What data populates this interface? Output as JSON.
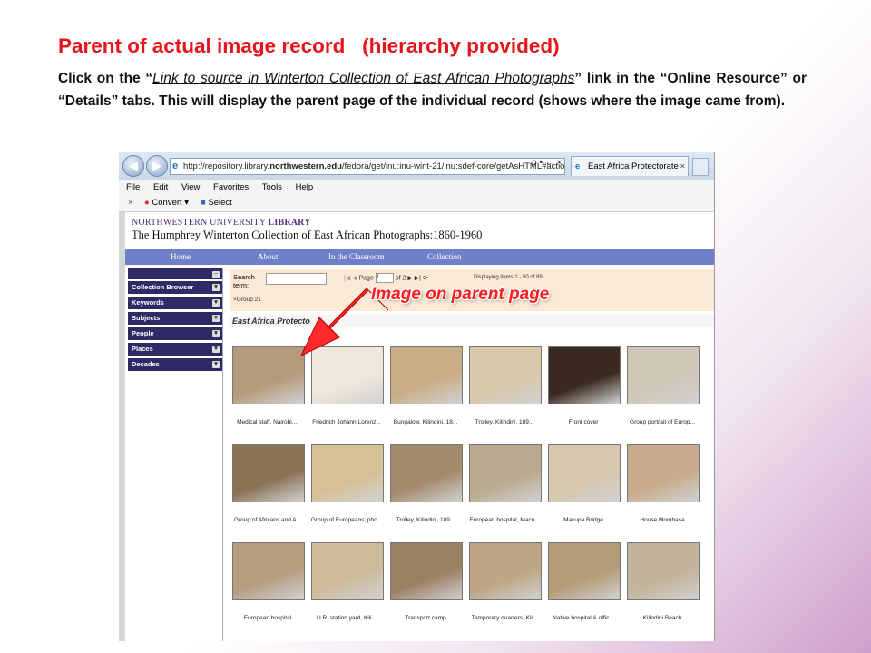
{
  "slide": {
    "title": "Parent of actual image record   (hierarchy provided)",
    "body_prefix": "Click on the “",
    "body_link": "Link to source in Winterton Collection of East African Photographs",
    "body_suffix": "” link in the “Online Resource” or “Details” tabs.  This will display the parent page of the individual record (shows where the image came from).",
    "callout": "Image on parent page"
  },
  "browser": {
    "url_prefix": "http://repository.library.",
    "url_bold": "northwestern.edu",
    "url_suffix": "/fedora/get/inu:inu-wint-21/inu:sdef-core/getAsHTML#actio",
    "addr_controls": "ρ • ← ×",
    "tab_title": "East Africa Protectorate",
    "menu": [
      "File",
      "Edit",
      "View",
      "Favorites",
      "Tools",
      "Help"
    ],
    "cmd_close": "×",
    "cmd_convert": "Convert",
    "cmd_select": "Select"
  },
  "site": {
    "library_name_regular": "NORTHWESTERN UNIVERSITY ",
    "library_name_bold": "LIBRARY",
    "collection_title": "The Humphrey Winterton Collection of East African Photographs:1860-1960",
    "nav": [
      "Home",
      "About",
      "In the Classroom",
      "Collection"
    ],
    "facets": [
      "Collection Browser",
      "Keywords",
      "Subjects",
      "People",
      "Places",
      "Decades"
    ],
    "search_label": "Search term:",
    "group_tag": "×Group 21",
    "pager_page_label": "Page",
    "pager_page_value": "1",
    "pager_of": "of 2",
    "displaying": "Displaying items 1 - 50 of 89",
    "results_title": "East Africa Protecto"
  },
  "thumbnails": [
    {
      "label": "Medical staff, Nairobi,...",
      "color": "#b49b7b"
    },
    {
      "label": "Friedrich Johann Lorenz...",
      "color": "#efe7db"
    },
    {
      "label": "Bungalow, Kilindini, 18...",
      "color": "#c9ad86"
    },
    {
      "label": "Trolley, Kilindini, 189...",
      "color": "#d8c7a8"
    },
    {
      "label": "Front cover",
      "color": "#3b2a20"
    },
    {
      "label": "Group portrait of Europ...",
      "color": "#cfc6b8"
    },
    {
      "label": "Group of Africans and A...",
      "color": "#8a7355"
    },
    {
      "label": "Group of Europeans; pho...",
      "color": "#d7c094"
    },
    {
      "label": "Trolley, Kilindini, 189...",
      "color": "#a38a6c"
    },
    {
      "label": "European hospital, Macu...",
      "color": "#b9a98f"
    },
    {
      "label": "Macupa Bridge",
      "color": "#d6c7ad"
    },
    {
      "label": "House Mombasa",
      "color": "#c8ab8a"
    },
    {
      "label": "European hospital",
      "color": "#b69d80"
    },
    {
      "label": "U.R. station yard, Kili...",
      "color": "#cdbb9c"
    },
    {
      "label": "Transport camp",
      "color": "#9b8063"
    },
    {
      "label": "Temporary quarters, Kil...",
      "color": "#bea684"
    },
    {
      "label": "Native hospital & offic...",
      "color": "#b59c78"
    },
    {
      "label": "Kilindini Beach",
      "color": "#c3b39a"
    }
  ]
}
